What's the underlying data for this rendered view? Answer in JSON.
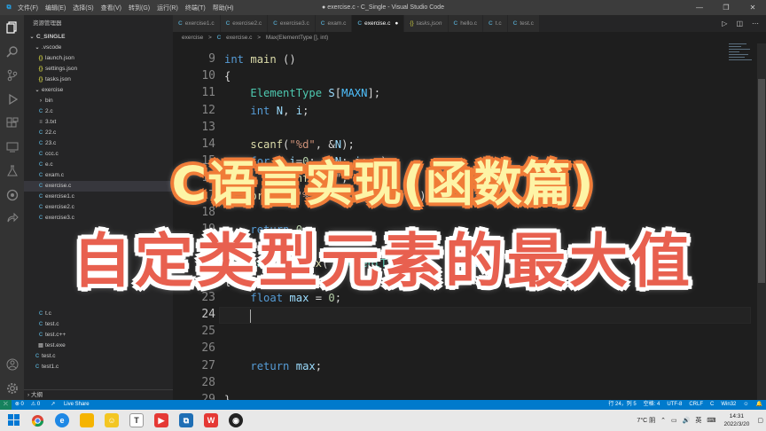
{
  "titlebar": {
    "menu": [
      "文件(F)",
      "编辑(E)",
      "选择(S)",
      "查看(V)",
      "转到(G)",
      "运行(R)",
      "终端(T)",
      "帮助(H)"
    ],
    "title": "● exercise.c - C_Single - Visual Studio Code",
    "minimize": "—",
    "restore": "❐",
    "close": "✕"
  },
  "sidebar": {
    "header": "资源管理器",
    "root": "C_SINGLE",
    "items": [
      {
        "label": ".vscode",
        "kind": "folder-open"
      },
      {
        "label": "launch.json",
        "kind": "json"
      },
      {
        "label": "settings.json",
        "kind": "json"
      },
      {
        "label": "tasks.json",
        "kind": "json"
      },
      {
        "label": "exercise",
        "kind": "folder-open"
      },
      {
        "label": "bin",
        "kind": "folder"
      },
      {
        "label": "2.c",
        "kind": "c"
      },
      {
        "label": "3.txt",
        "kind": "txt"
      },
      {
        "label": "22.c",
        "kind": "c"
      },
      {
        "label": "23.c",
        "kind": "c"
      },
      {
        "label": "ccc.c",
        "kind": "c"
      },
      {
        "label": "e.c",
        "kind": "c"
      },
      {
        "label": "exam.c",
        "kind": "c"
      },
      {
        "label": "exercise.c",
        "kind": "c"
      },
      {
        "label": "exercise1.c",
        "kind": "c"
      },
      {
        "label": "exercise2.c",
        "kind": "c"
      },
      {
        "label": "exercise3.c",
        "kind": "c"
      },
      {
        "label": "t.c",
        "kind": "c"
      },
      {
        "label": "test.c",
        "kind": "c"
      },
      {
        "label": "test.c++",
        "kind": "c"
      },
      {
        "label": "test.exe",
        "kind": "exe"
      },
      {
        "label": "test.c",
        "kind": "c"
      },
      {
        "label": "test1.c",
        "kind": "c"
      }
    ],
    "outline": "大纲"
  },
  "tabs": [
    {
      "label": "exercise1.c",
      "kind": "c"
    },
    {
      "label": "exercise2.c",
      "kind": "c"
    },
    {
      "label": "exercise3.c",
      "kind": "c"
    },
    {
      "label": "exam.c",
      "kind": "c"
    },
    {
      "label": "exercise.c",
      "kind": "c"
    },
    {
      "label": "tasks.json",
      "kind": "json"
    },
    {
      "label": "hello.c",
      "kind": "c"
    },
    {
      "label": "t.c",
      "kind": "c"
    },
    {
      "label": "test.c",
      "kind": "c"
    }
  ],
  "breadcrumb": [
    "exercise",
    ">",
    "C",
    "exercise.c",
    ">",
    "Max(ElementType [], int)"
  ],
  "editor": {
    "lines": [
      {
        "n": "9",
        "html": "<span class='kw'>int</span> <span class='fn'>main</span> ()"
      },
      {
        "n": "10",
        "html": "{"
      },
      {
        "n": "11",
        "html": "    <span class='ty'>ElementType</span> <span class='var'>S</span>[<span class='mac'>MAXN</span>];"
      },
      {
        "n": "12",
        "html": "    <span class='kw'>int</span> <span class='var'>N</span>, <span class='var'>i</span>;"
      },
      {
        "n": "13",
        "html": ""
      },
      {
        "n": "14",
        "html": "    <span class='fn'>scanf</span>(<span class='str'>\"%d\"</span>, &amp;<span class='var'>N</span>);"
      },
      {
        "n": "15",
        "html": "    <span class='kw'>for</span> ( <span class='var'>i</span>=<span class='num'>0</span>; <span class='var'>i</span>&lt;<span class='var'>N</span>; <span class='var'>i</span>++ )"
      },
      {
        "n": "16",
        "html": "        <span class='fn'>scanf</span>(<span class='str'>\"%f\"</span>, &amp;<span class='var'>S</span>[<span class='var'>i</span>]);"
      },
      {
        "n": "17",
        "html": "    <span class='fn'>printf</span>(<span class='str'>\"%.2f\\n\"</span>, <span class='fn'>Max</span>(<span class='var'>S</span>, <span class='var'>N</span>));"
      },
      {
        "n": "18",
        "html": ""
      },
      {
        "n": "19",
        "html": "    <span class='kw'>return</span> <span class='num'>0</span>;"
      },
      {
        "n": "20",
        "html": "}"
      },
      {
        "n": "21",
        "html": "<span class='ty'>ElementType</span> <span class='fn'>Max</span>( <span class='ty'>ElementType</span> <span class='var'>S</span>[], <span class='kw'>int</span> <span class='var'>N</span> )"
      },
      {
        "n": "22",
        "html": "{"
      },
      {
        "n": "23",
        "html": "    <span class='kw'>float</span> <span class='var'>max</span> = <span class='num'>0</span>;"
      },
      {
        "n": "24",
        "html": "    "
      },
      {
        "n": "25",
        "html": ""
      },
      {
        "n": "26",
        "html": ""
      },
      {
        "n": "27",
        "html": "    <span class='kw'>return</span> <span class='var'>max</span>;"
      },
      {
        "n": "28",
        "html": ""
      },
      {
        "n": "29",
        "html": "}"
      }
    ],
    "current_line": "24"
  },
  "statusbar": {
    "remote": "⤫",
    "errors": "⊗ 0",
    "warnings": "⚠ 0",
    "liveshare": "Live Share",
    "position": "行 24，列 5",
    "spaces": "空格: 4",
    "encoding": "UTF-8",
    "eol": "CRLF",
    "language": "C",
    "platform": "Win32"
  },
  "taskbar": {
    "weather": "7°C 阴",
    "ime": "英",
    "time": "14:31",
    "date": "2022/3/20"
  },
  "overlay": {
    "line1": "C语言实现(函数篇)",
    "line2": "自定类型元素的最大值"
  },
  "colors": {
    "statusbar": "#007acc",
    "overlay1_fill": "#fdf4a6",
    "overlay1_stroke": "#f07c38",
    "overlay2_fill": "#e8604f"
  }
}
